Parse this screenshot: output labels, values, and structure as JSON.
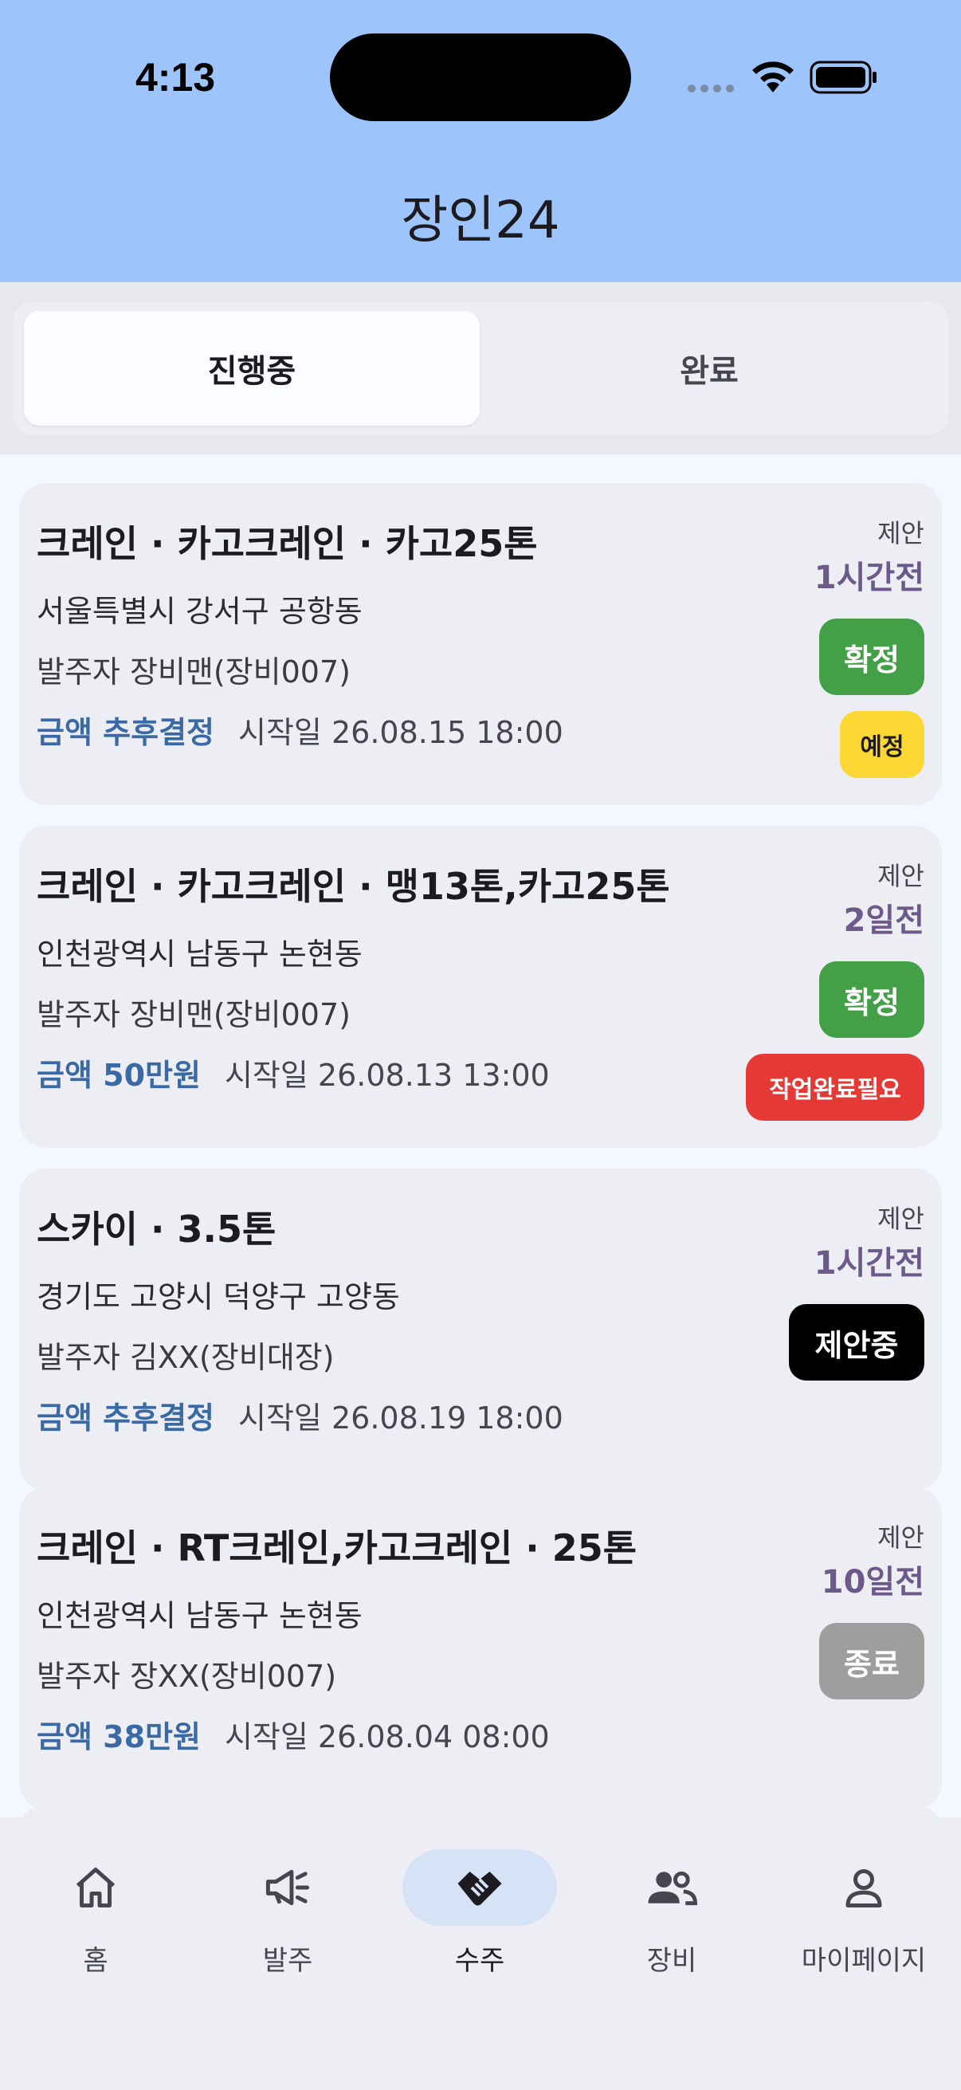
{
  "status_bar": {
    "time": "4:13"
  },
  "header": {
    "title": "장인24"
  },
  "tabs": [
    {
      "label": "진행중",
      "active": true
    },
    {
      "label": "완료",
      "active": false
    }
  ],
  "orders": [
    {
      "title": "크레인 · 카고크레인 · 카고25톤",
      "address": "서울특별시 강서구 공항동",
      "orderer": "발주자 장비맨(장비007)",
      "price": "금액 추후결정",
      "start": "시작일 26.08.15 18:00",
      "proposal_label": "제안",
      "proposal_time": "1시간전",
      "badge_main": "확정",
      "badge_main_color": "#43a047",
      "badge_sub": "예정",
      "badge_sub_color": "#fdd835",
      "badge_sub_text_color": "#1d1b20"
    },
    {
      "title": "크레인 · 카고크레인 · 맹13톤,카고25톤",
      "address": "인천광역시 남동구 논현동",
      "orderer": "발주자 장비맨(장비007)",
      "price": "금액 50만원",
      "start": "시작일 26.08.13 13:00",
      "proposal_label": "제안",
      "proposal_time": "2일전",
      "badge_main": "확정",
      "badge_main_color": "#43a047",
      "badge_sub": "작업완료필요",
      "badge_sub_color": "#e53935",
      "badge_sub_text_color": "#ffffff"
    },
    {
      "title": "스카이 · 3.5톤",
      "address": "경기도 고양시 덕양구 고양동",
      "orderer": "발주자 김XX(장비대장)",
      "price": "금액 추후결정",
      "start": "시작일 26.08.19 18:00",
      "proposal_label": "제안",
      "proposal_time": "1시간전",
      "badge_main": "제안중",
      "badge_main_color": "#000000"
    },
    {
      "title": "크레인 · RT크레인,카고크레인 · 25톤",
      "address": "인천광역시 남동구 논현동",
      "orderer": "발주자 장XX(장비007)",
      "price": "금액 38만원",
      "start": "시작일 26.08.04 08:00",
      "proposal_label": "제안",
      "proposal_time": "10일전",
      "badge_main": "종료",
      "badge_main_color": "#9e9e9e"
    }
  ],
  "bottom_nav": [
    {
      "label": "홈",
      "icon": "home-icon",
      "active": false
    },
    {
      "label": "발주",
      "icon": "megaphone-icon",
      "active": false
    },
    {
      "label": "수주",
      "icon": "handshake-icon",
      "active": true
    },
    {
      "label": "장비",
      "icon": "people-icon",
      "active": false
    },
    {
      "label": "마이페이지",
      "icon": "person-icon",
      "active": false
    }
  ]
}
